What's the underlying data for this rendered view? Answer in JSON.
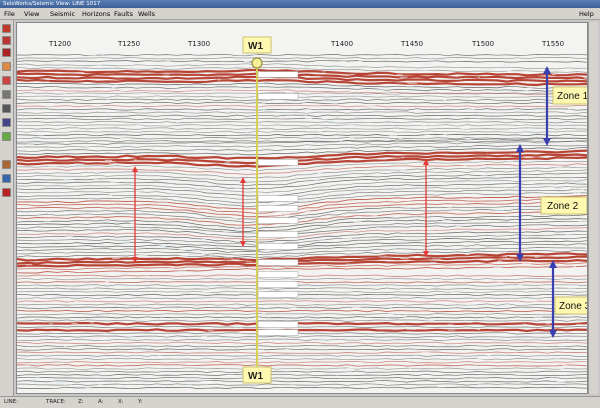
{
  "window": {
    "title": "SeisWorks/Seismic View: LINE 1017"
  },
  "menu": {
    "file": "File",
    "view": "View",
    "seismic": "Seismic",
    "horizons": "Horizons",
    "faults": "Faults",
    "wells": "Wells",
    "help": "Help"
  },
  "toolbar": {
    "tools": [
      {
        "name": "zoom-tool",
        "color": "#c0392b"
      },
      {
        "name": "pan-tool",
        "color": "#b33"
      },
      {
        "name": "stop-tool",
        "color": "#a22"
      },
      {
        "name": "pick-tool",
        "color": "#d84"
      },
      {
        "name": "layer-tool",
        "color": "#c44"
      },
      {
        "name": "pencil-tool",
        "color": "#777"
      },
      {
        "name": "ruler-tool",
        "color": "#555"
      },
      {
        "name": "grid-tool",
        "color": "#448"
      },
      {
        "name": "color-tool",
        "color": "#6a4"
      },
      {
        "name": "fault-tool",
        "color": "#a63"
      },
      {
        "name": "horizon-tool",
        "color": "#36a"
      },
      {
        "name": "record-tool",
        "color": "#b22"
      }
    ]
  },
  "section": {
    "trace_labels": [
      "T1200",
      "T1250",
      "T1300",
      "T1400",
      "T1450",
      "T1500",
      "T1550"
    ],
    "well_top": "W1",
    "well_bottom": "W1",
    "zones": [
      "Zone 1",
      "Zone 2",
      "Zone 3"
    ],
    "picks": [
      "",
      "",
      "",
      "",
      "",
      "",
      "",
      "",
      "",
      "",
      "",
      "",
      "",
      ""
    ]
  },
  "status": {
    "line": "LINE:",
    "trace": "TRACE:",
    "z": "Z:",
    "a": "A:",
    "x": "X:",
    "y": "Y:"
  },
  "colors": {
    "seismic_red": "#b33a2a",
    "seismic_dark": "#3a3a3a",
    "arrow_red": "#e53935",
    "arrow_blue": "#3a3fb0",
    "well_line": "#d8d050",
    "zone_box": "#fff8b0"
  }
}
